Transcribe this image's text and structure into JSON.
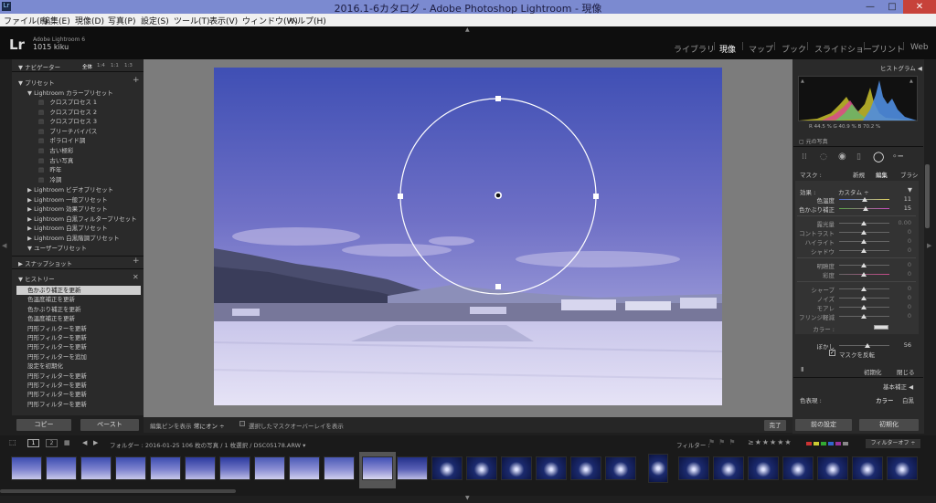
{
  "window": {
    "title": "2016.1-6カタログ - Adobe Photoshop Lightroom - 現像"
  },
  "menu": [
    "ファイル(F)",
    "編集(E)",
    "現像(D)",
    "写真(P)",
    "設定(S)",
    "ツール(T)",
    "表示(V)",
    "ウィンドウ(W)",
    "ヘルプ(H)"
  ],
  "identity": {
    "logo": "Lr",
    "app": "Adobe Lightroom 6",
    "user": "1015 kiku"
  },
  "modules": [
    "ライブラリ",
    "現像",
    "マップ",
    "ブック",
    "スライドショー",
    "プリント",
    "Web"
  ],
  "navigator": {
    "title": "ナビゲーター",
    "zoom": [
      "全体",
      "1:4",
      "1:1",
      "1:3"
    ]
  },
  "presets": {
    "title": "プリセット",
    "open_folder": "Lightroom カラープリセット",
    "items": [
      "クロスプロセス 1",
      "クロスプロセス 2",
      "クロスプロセス 3",
      "ブリーチバイパス",
      "ポラロイド調",
      "古い極彩",
      "古い写真",
      "昨年",
      "冷調"
    ],
    "folders": [
      "Lightroom ビデオプリセット",
      "Lightroom 一般プリセット",
      "Lightroom 効果プリセット",
      "Lightroom 白黒フィルタープリセット",
      "Lightroom 白黒プリセット",
      "Lightroom 白黒階調プリセット",
      "ユーザープリセット"
    ]
  },
  "snapshot": {
    "title": "スナップショット"
  },
  "history": {
    "title": "ヒストリー",
    "items": [
      "色かぶり補正を更新",
      "色温度補正を更新",
      "色かぶり補正を更新",
      "色温度補正を更新",
      "円形フィルターを更新",
      "円形フィルターを更新",
      "円形フィルターを更新",
      "円形フィルターを追加",
      "設定を初期化",
      "円形フィルターを更新",
      "円形フィルターを更新",
      "円形フィルターを更新",
      "円形フィルターを更新"
    ]
  },
  "left_buttons": {
    "copy": "コピー",
    "paste": "ペースト"
  },
  "toolbar": {
    "pins_label": "編集ピンを表示 :",
    "pins_value": "常にオン ÷",
    "overlay": "選択したマスクオーバーレイを表示",
    "done": "完了"
  },
  "right": {
    "histogram_title": "ヒストグラム",
    "rgb": "R  44.5  %  G  40.9  %  B  70.2  %",
    "original": "元の写真",
    "mask_label": "マスク :",
    "mask_new": "新規",
    "mask_edit": "編集",
    "mask_brush": "ブラシ",
    "effect_label": "効果 :",
    "effect_value": "カスタム ÷",
    "sliders": [
      {
        "label": "色温度",
        "value": "11"
      },
      {
        "label": "色かぶり補正",
        "value": "15"
      },
      {
        "label": "露光量",
        "value": "0.00"
      },
      {
        "label": "コントラスト",
        "value": "0"
      },
      {
        "label": "ハイライト",
        "value": "0"
      },
      {
        "label": "シャドウ",
        "value": "0"
      },
      {
        "label": "明瞭度",
        "value": "0"
      },
      {
        "label": "彩度",
        "value": "0"
      },
      {
        "label": "シャープ",
        "value": "0"
      },
      {
        "label": "ノイズ",
        "value": "0"
      },
      {
        "label": "モアレ",
        "value": "0"
      },
      {
        "label": "フリンジ軽減",
        "value": "0"
      }
    ],
    "color_label": "カラー :",
    "feather_label": "ぼかし",
    "feather_value": "56",
    "invert": "マスクを反転",
    "reset": "初期化",
    "close": "閉じる",
    "basic_title": "基本補正",
    "treatment_label": "色表現 :",
    "treatment_color": "カラー",
    "treatment_bw": "白黒",
    "prev_button": "前の設定",
    "reset_button": "初期化"
  },
  "filmstrip": {
    "pages": [
      "1",
      "2"
    ],
    "info": "フォルダー : 2016-01-25   106 枚の写真 / 1 枚選択 / DSC05178.ARW ▾",
    "filter_label": "フィルター :",
    "filter_off": "フィルターオフ ÷"
  },
  "colors": {
    "accent": "#7b8ad0",
    "panel": "#2a2a2a",
    "bg": "#1f1f1f"
  }
}
